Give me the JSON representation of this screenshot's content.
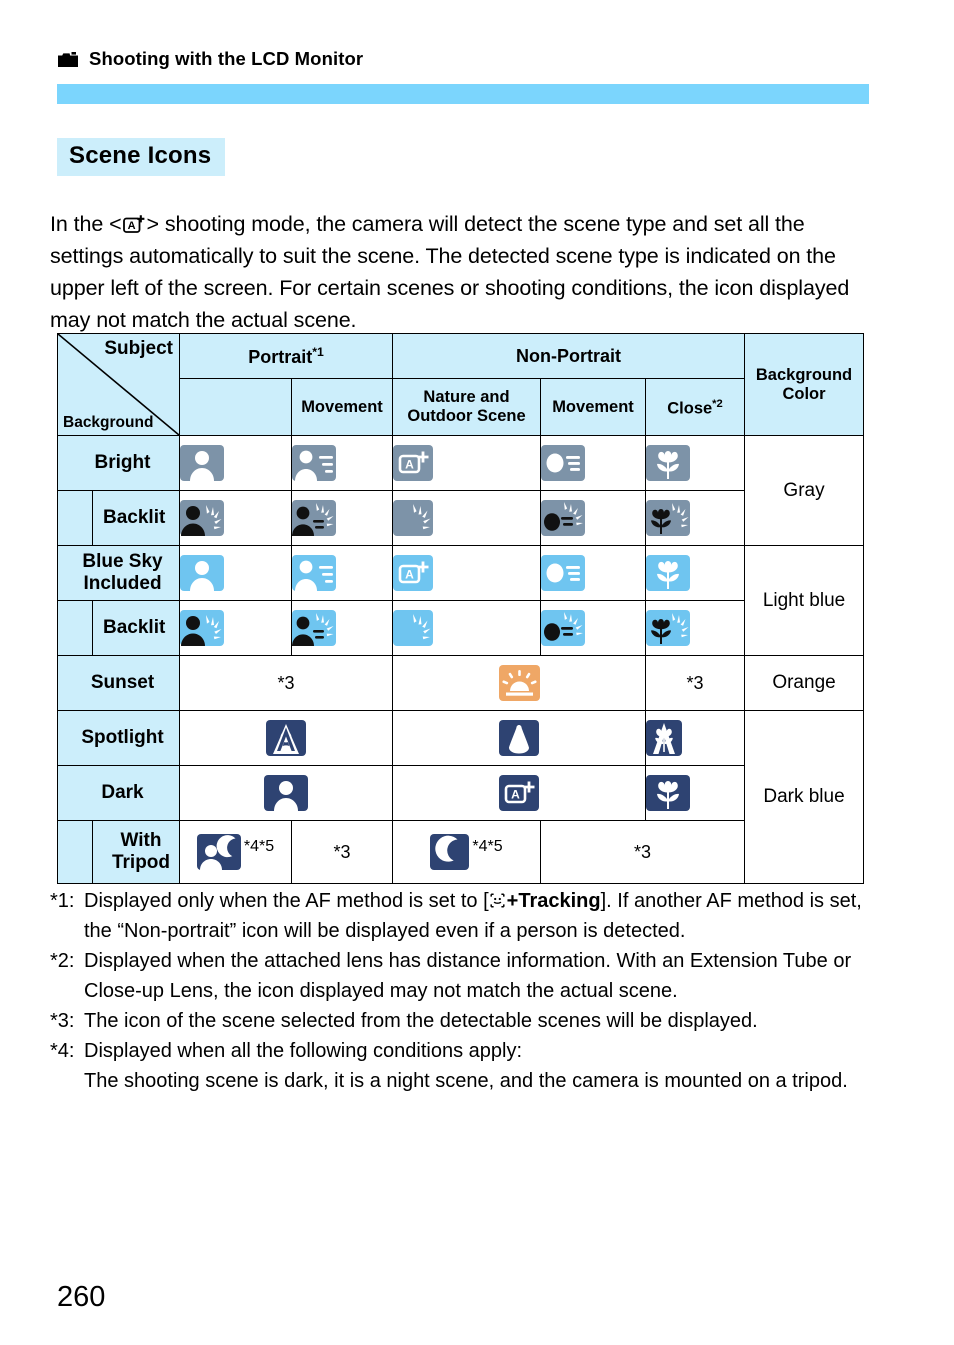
{
  "running_head": {
    "icon": "camera-icon",
    "text": "Shooting with the LCD Monitor"
  },
  "section": {
    "title": "Scene Icons"
  },
  "intro": {
    "part1": "In the <",
    "mode_icon": "scene-intelligent-auto-icon",
    "part2": "> shooting mode, the camera will detect the scene type and set all the settings automatically to suit the scene. The detected scene type is indicated on the upper left of the screen. For certain scenes or shooting conditions, the icon displayed may not match the actual scene."
  },
  "table": {
    "corner": {
      "subject": "Subject",
      "background": "Background"
    },
    "headers": {
      "portrait": "Portrait",
      "portrait_note": "*1",
      "non_portrait": "Non-Portrait",
      "movement": "Movement",
      "nature": "Nature and Outdoor Scene",
      "movement2": "Movement",
      "close": "Close",
      "close_note": "*2",
      "background_color": "Background Color"
    },
    "rows": [
      {
        "label": "Bright",
        "type": "main"
      },
      {
        "label": "Backlit",
        "type": "sub"
      },
      {
        "label": "Blue Sky Included",
        "type": "main"
      },
      {
        "label": "Backlit",
        "type": "sub"
      },
      {
        "label": "Sunset",
        "type": "main"
      },
      {
        "label": "Spotlight",
        "type": "main"
      },
      {
        "label": "Dark",
        "type": "main"
      },
      {
        "label": "With Tripod",
        "type": "sub"
      }
    ],
    "background_colors": [
      {
        "label": "Gray",
        "rows": 2
      },
      {
        "label": "Light blue",
        "rows": 2
      },
      {
        "label": "Orange",
        "rows": 1
      },
      {
        "label": "Dark blue",
        "rows": 3
      }
    ],
    "marks": {
      "note3": "*3",
      "note45": "*4*5"
    },
    "icons": {
      "bright": [
        "portrait-icon",
        "portrait-movement-icon",
        "auto-plus-icon",
        "movement-icon",
        "close-up-icon"
      ],
      "bright_backlit": [
        "portrait-backlit-icon",
        "portrait-movement-backlit-icon",
        "backlit-icon",
        "movement-backlit-icon",
        "close-up-backlit-icon"
      ],
      "blue_sky": [
        "portrait-icon",
        "portrait-movement-icon",
        "auto-plus-icon",
        "movement-icon",
        "close-up-icon"
      ],
      "blue_sky_backlit": [
        "portrait-backlit-icon",
        "portrait-movement-backlit-icon",
        "backlit-icon",
        "movement-backlit-icon",
        "close-up-backlit-icon"
      ],
      "sunset": [
        "sunset-icon"
      ],
      "spotlight": [
        "portrait-spotlight-icon",
        "spotlight-icon",
        "close-up-spotlight-icon"
      ],
      "dark": [
        "portrait-dark-icon",
        "auto-plus-dark-icon",
        "close-up-dark-icon"
      ],
      "tripod": [
        "night-portrait-icon",
        "night-scene-icon"
      ]
    }
  },
  "footnotes": [
    {
      "marker": "*1:",
      "text_before": "Displayed only when the AF method is set to [",
      "icon": "face-tracking-icon",
      "bold": "+Tracking",
      "text_after": "]. If another AF method is set, the “Non-portrait” icon will be displayed even if a person is detected."
    },
    {
      "marker": "*2:",
      "text": "Displayed when the attached lens has distance information. With an Extension Tube or Close-up Lens, the icon displayed may not match the actual scene."
    },
    {
      "marker": "*3:",
      "text": "The icon of the scene selected from the detectable scenes will be displayed."
    },
    {
      "marker": "*4:",
      "text": "Displayed when all the following conditions apply:",
      "continuation": "The shooting scene is dark, it is a night scene, and the camera is mounted on a tripod."
    }
  ],
  "page_number": "260",
  "colors": {
    "header_bar": "#7BD5FD",
    "header_cell": "#CCEEFB",
    "icon_gray": "#7D93A8",
    "icon_light_blue": "#6FC5F0",
    "icon_dark_blue": "#2E4372",
    "icon_orange": "#EFA societies66"
  }
}
